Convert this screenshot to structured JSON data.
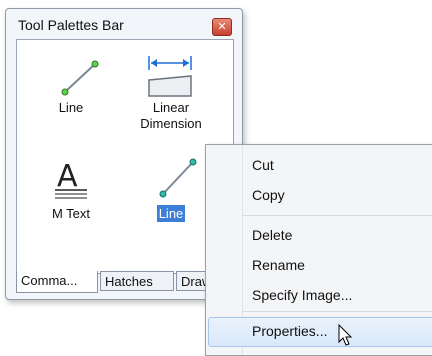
{
  "palette": {
    "title": "Tool Palettes Bar",
    "tools": [
      {
        "label": "Line"
      },
      {
        "label": "Linear\nDimension"
      },
      {
        "label": "M Text"
      },
      {
        "label": "Line"
      }
    ],
    "tabs": [
      "Comma...",
      "Hatches",
      "Draw"
    ]
  },
  "context_menu": {
    "items": [
      "Cut",
      "Copy",
      "Delete",
      "Rename",
      "Specify Image...",
      "Properties..."
    ],
    "highlighted": "Properties..."
  },
  "colors": {
    "selection": "#3d7fd6",
    "menu_highlight": "#d9e8fa",
    "line_icon_green": "#5bd34a",
    "dimension_blue": "#1d6fd6"
  }
}
